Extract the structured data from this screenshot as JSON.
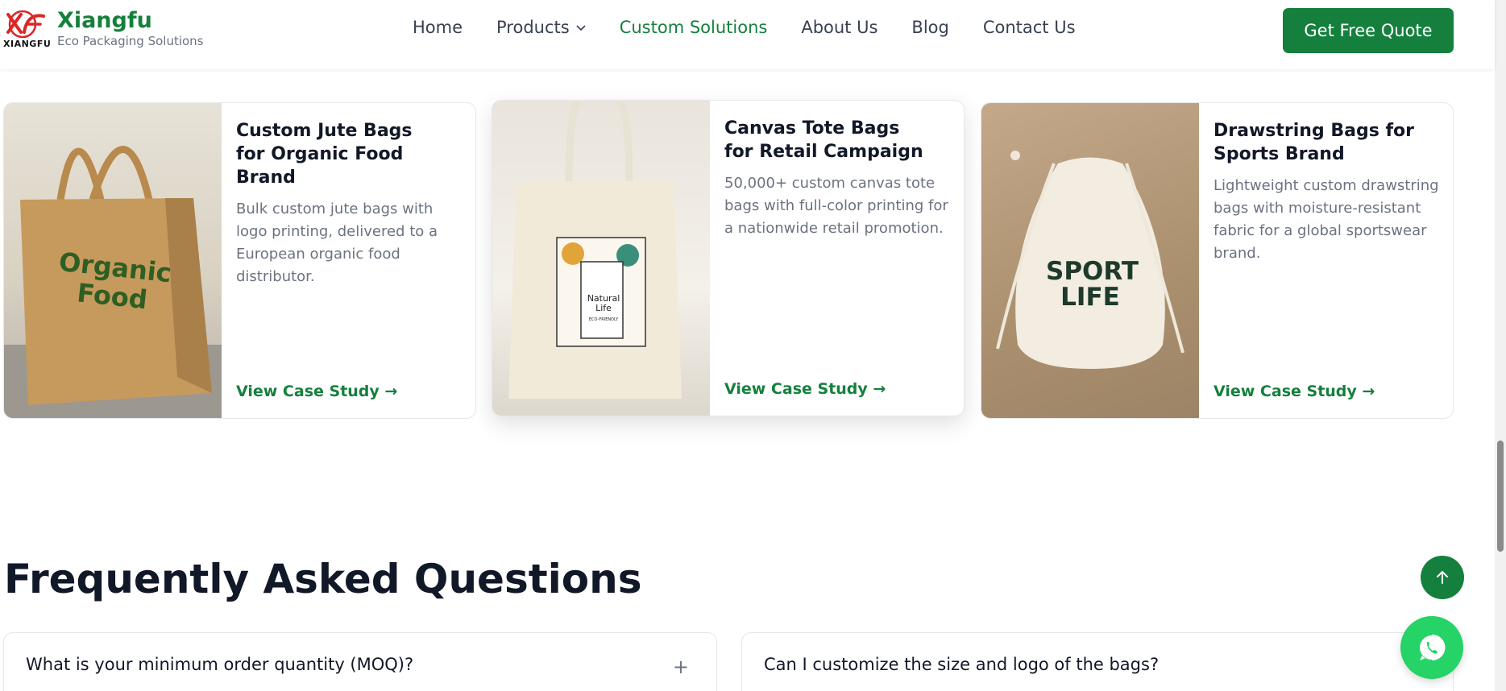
{
  "header": {
    "logo_small": "XIANGFU",
    "brand_name": "Xiangfu",
    "brand_sub": "Eco Packaging Solutions",
    "nav": [
      {
        "label": "Home"
      },
      {
        "label": "Products"
      },
      {
        "label": "Custom Solutions"
      },
      {
        "label": "About Us"
      },
      {
        "label": "Blog"
      },
      {
        "label": "Contact Us"
      }
    ],
    "quote_button": "Get Free Quote"
  },
  "cards": [
    {
      "title": "Custom Jute Bags for Organic Food Brand",
      "description": "Bulk custom jute bags with logo printing, delivered to a European organic food distributor.",
      "cta": "View Case Study →",
      "image_text_1": "Organic",
      "image_text_2": "Food"
    },
    {
      "title": "Canvas Tote Bags for Retail Campaign",
      "description": "50,000+ custom canvas tote bags with full-color printing for a nationwide retail promotion.",
      "cta": "View Case Study →",
      "image_text_1": "Natural",
      "image_text_2": "Life",
      "image_text_3": "ECO-FRIENDLY"
    },
    {
      "title": "Drawstring Bags for Sports Brand",
      "description": "Lightweight custom drawstring bags with moisture-resistant fabric for a global sportswear brand.",
      "cta": "View Case Study →",
      "image_text_1": "SPORT",
      "image_text_2": "LIFE"
    }
  ],
  "faq": {
    "heading": "Frequently Asked Questions",
    "items": [
      {
        "question": "What is your minimum order quantity (MOQ)?"
      },
      {
        "question": "Can I customize the size and logo of the bags?"
      }
    ]
  },
  "colors": {
    "accent": "#15803d",
    "whatsapp": "#25d366"
  }
}
